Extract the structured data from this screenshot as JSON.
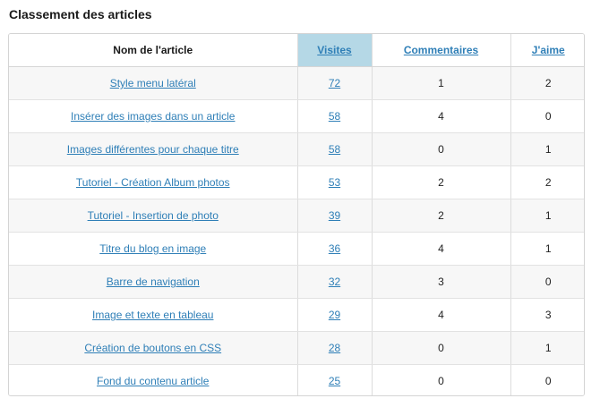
{
  "page": {
    "title": "Classement des articles"
  },
  "table": {
    "headers": {
      "name": "Nom de l'article",
      "visits": "Visites",
      "comments": "Commentaires",
      "likes": "J'aime"
    },
    "sorted_column": "visits",
    "rows": [
      {
        "name": "Style menu latéral",
        "visits": "72",
        "comments": "1",
        "likes": "2"
      },
      {
        "name": "Insérer des images dans un article",
        "visits": "58",
        "comments": "4",
        "likes": "0"
      },
      {
        "name": "Images différentes pour chaque titre",
        "visits": "58",
        "comments": "0",
        "likes": "1"
      },
      {
        "name": "Tutoriel - Création Album photos",
        "visits": "53",
        "comments": "2",
        "likes": "2"
      },
      {
        "name": "Tutoriel - Insertion de photo",
        "visits": "39",
        "comments": "2",
        "likes": "1"
      },
      {
        "name": "Titre du blog en image",
        "visits": "36",
        "comments": "4",
        "likes": "1"
      },
      {
        "name": "Barre de navigation",
        "visits": "32",
        "comments": "3",
        "likes": "0"
      },
      {
        "name": "Image et texte en tableau",
        "visits": "29",
        "comments": "4",
        "likes": "3"
      },
      {
        "name": "Création de boutons en CSS",
        "visits": "28",
        "comments": "0",
        "likes": "1"
      },
      {
        "name": "Fond du contenu article",
        "visits": "25",
        "comments": "0",
        "likes": "0"
      }
    ]
  },
  "colors": {
    "link": "#2f7fb7",
    "sorted_header_bg": "#b5d8e6",
    "row_alt_bg": "#f7f7f7",
    "border": "#d4d4d4"
  }
}
